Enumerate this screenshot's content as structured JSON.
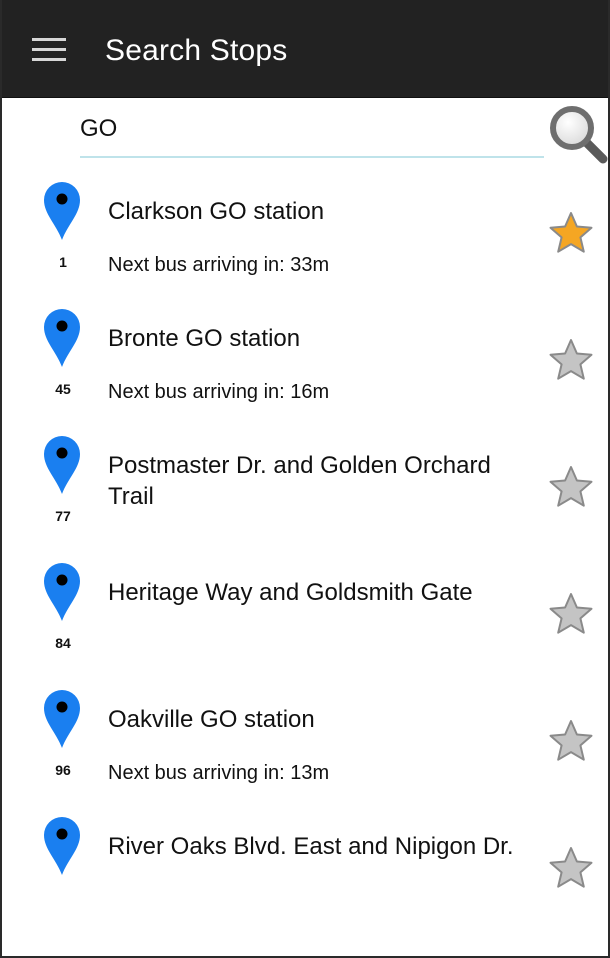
{
  "header": {
    "title": "Search Stops",
    "menu_icon": "hamburger-menu-icon"
  },
  "search": {
    "value": "GO",
    "icon": "magnifier-icon"
  },
  "colors": {
    "appbar": "#222222",
    "pin": "#1a7ff0",
    "star_active": "#f5a623",
    "star_inactive": "#c4c4c4",
    "input_underline": "#bfe3ea"
  },
  "stops": [
    {
      "number": "1",
      "name": "Clarkson GO station",
      "arrival": "Next bus arriving in: 33m",
      "favorite": true
    },
    {
      "number": "45",
      "name": "Bronte GO station",
      "arrival": "Next bus arriving in: 16m",
      "favorite": false
    },
    {
      "number": "77",
      "name": "Postmaster Dr. and Golden Orchard Trail",
      "arrival": "",
      "favorite": false
    },
    {
      "number": "84",
      "name": "Heritage Way and Goldsmith Gate",
      "arrival": "",
      "favorite": false
    },
    {
      "number": "96",
      "name": "Oakville GO station",
      "arrival": "Next bus arriving in: 13m",
      "favorite": false
    },
    {
      "number": "",
      "name": "River Oaks Blvd. East and Nipigon Dr.",
      "arrival": "",
      "favorite": false
    }
  ]
}
